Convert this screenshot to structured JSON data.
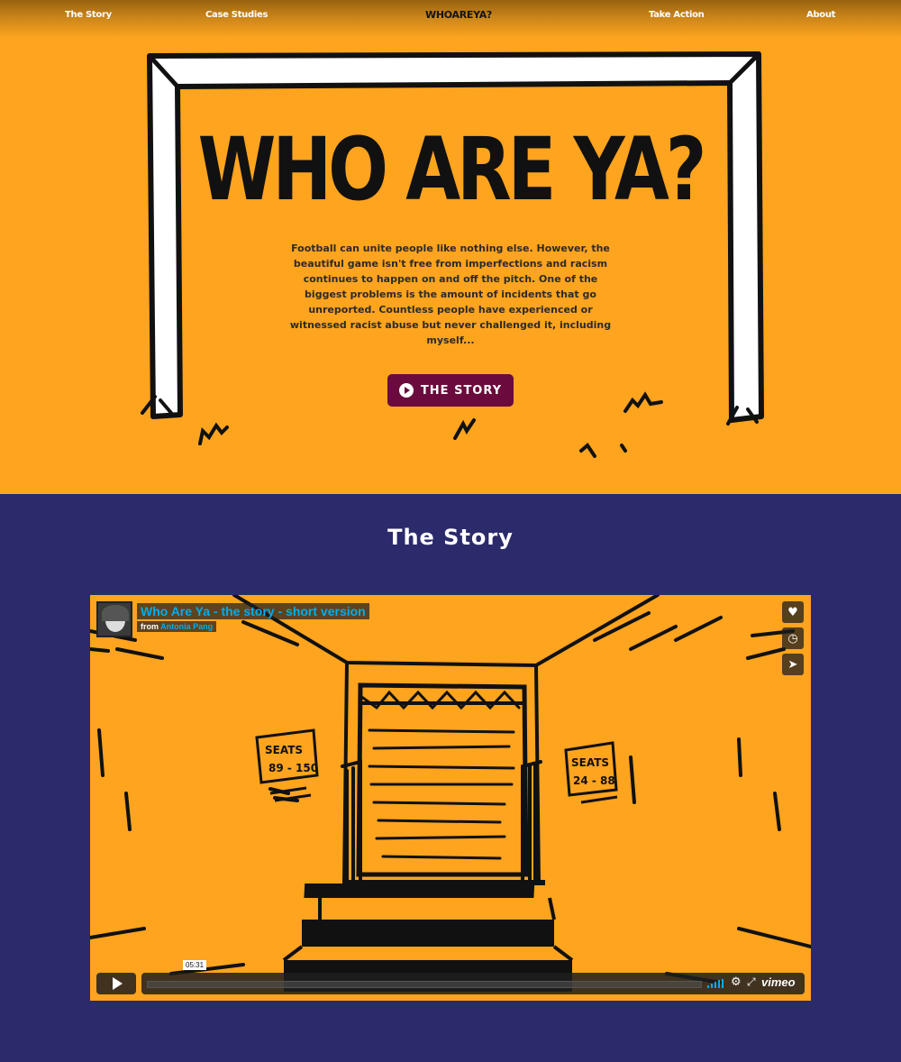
{
  "nav": {
    "items": [
      "The Story",
      "Case Studies",
      "Take Action",
      "About"
    ],
    "logo": "WHOAREYA?"
  },
  "hero": {
    "title": "WHO ARE YA?",
    "intro": "Football can unite people like nothing else. However, the beautiful game isn't free from imperfections and racism continues to happen on and off the pitch. One of the biggest problems is the amount of incidents that go unreported. Countless people have experienced or witnessed racist abuse but never challenged it, including myself...",
    "button_label": "THE STORY",
    "background": "#fea41e",
    "button_color": "#6b0a3c"
  },
  "story_section": {
    "title": "The Story",
    "background": "#2b2a6b"
  },
  "video": {
    "title": "Who Are Ya - the story - short version",
    "from_label": "from",
    "author": "Antonia Pang",
    "duration": "05:31",
    "brand": "vimeo",
    "sign_left": [
      "SEATS",
      "89 - 150"
    ],
    "sign_right": [
      "SEATS",
      "24 - 88"
    ],
    "side_icons": [
      "heart-icon",
      "clock-icon",
      "send-icon"
    ]
  }
}
